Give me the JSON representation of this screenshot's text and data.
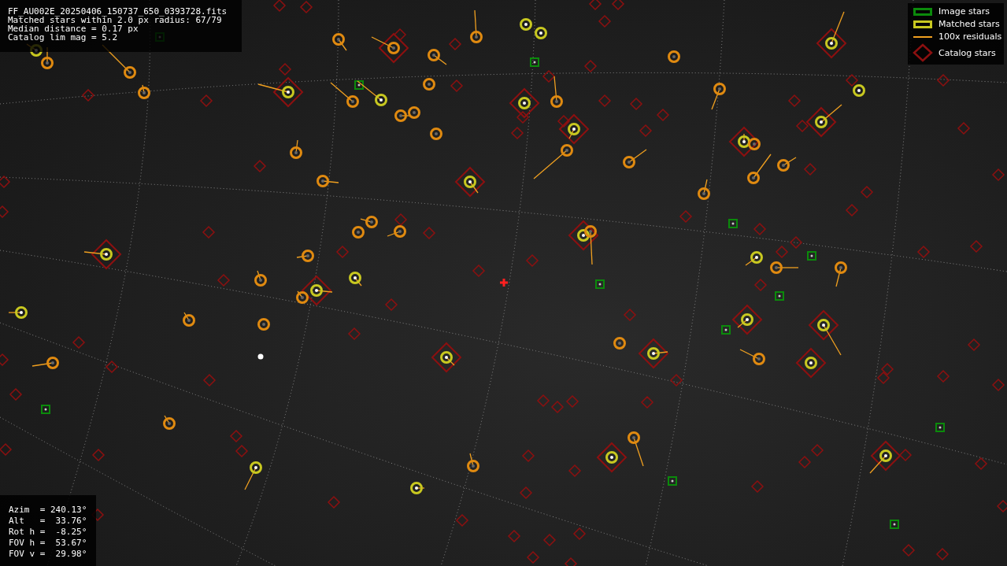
{
  "file_info": {
    "lines": [
      "FF_AU002E_20250406_150737_650_0393728.fits",
      "Matched stars within 2.0 px radius: 67/79",
      "Median distance = 0.17 px",
      "Catalog lim mag = 5.2"
    ]
  },
  "legend": {
    "items": [
      {
        "kind": "box",
        "label": "Image stars",
        "color": "#0b8a0b"
      },
      {
        "kind": "box",
        "label": "Matched stars",
        "color": "#c8c820"
      },
      {
        "kind": "line",
        "label": "100x residuals",
        "color": "#f0a020"
      },
      {
        "kind": "diamond",
        "label": "Catalog stars",
        "color": "#8c1010"
      }
    ]
  },
  "pointing": {
    "lines": [
      "Azim  = 240.13°",
      "Alt   =  33.76°",
      "Rot h =  -8.25°",
      "FOV h =  53.67°",
      "FOV v =  29.98°"
    ]
  }
}
